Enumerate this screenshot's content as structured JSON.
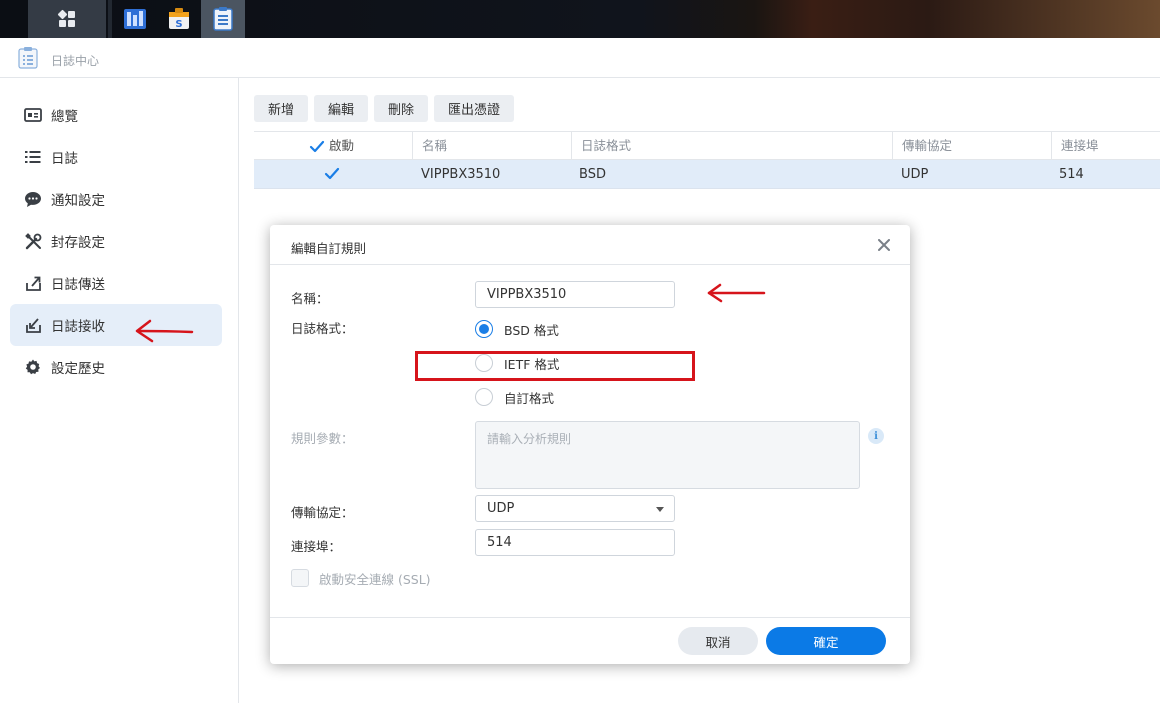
{
  "window": {
    "title": "日誌中心"
  },
  "sidebar": {
    "items": [
      {
        "label": "總覽",
        "icon": "overview-icon"
      },
      {
        "label": "日誌",
        "icon": "list-icon"
      },
      {
        "label": "通知設定",
        "icon": "chat-bubble-icon"
      },
      {
        "label": "封存設定",
        "icon": "tools-icon"
      },
      {
        "label": "日誌傳送",
        "icon": "export-icon"
      },
      {
        "label": "日誌接收",
        "icon": "import-icon",
        "active": true
      },
      {
        "label": "設定歷史",
        "icon": "gear-icon"
      }
    ]
  },
  "toolbar": {
    "add_label": "新增",
    "edit_label": "編輯",
    "delete_label": "刪除",
    "export_cert_label": "匯出憑證"
  },
  "table": {
    "columns": [
      "啟動",
      "名稱",
      "日誌格式",
      "傳輸協定",
      "連接埠"
    ],
    "rows": [
      {
        "enabled": true,
        "name": "VIPPBX3510",
        "format": "BSD",
        "protocol": "UDP",
        "port": "514"
      }
    ]
  },
  "dialog": {
    "title": "編輯自訂規則",
    "name_label": "名稱：",
    "name_value": "VIPPBX3510",
    "format_label": "日誌格式：",
    "format_options": [
      "BSD 格式",
      "IETF 格式",
      "自訂格式"
    ],
    "format_selected": "BSD 格式",
    "rule_label": "規則參數：",
    "rule_placeholder": "請輸入分析規則",
    "protocol_label": "傳輸協定：",
    "protocol_value": "UDP",
    "port_label": "連接埠：",
    "port_value": "514",
    "ssl_label": "啟動安全連線 (SSL)",
    "cancel_label": "取消",
    "ok_label": "確定"
  },
  "colors": {
    "accent": "#0b7ae6",
    "selected_row": "#e1ecf9",
    "annotation": "#d6141b"
  }
}
